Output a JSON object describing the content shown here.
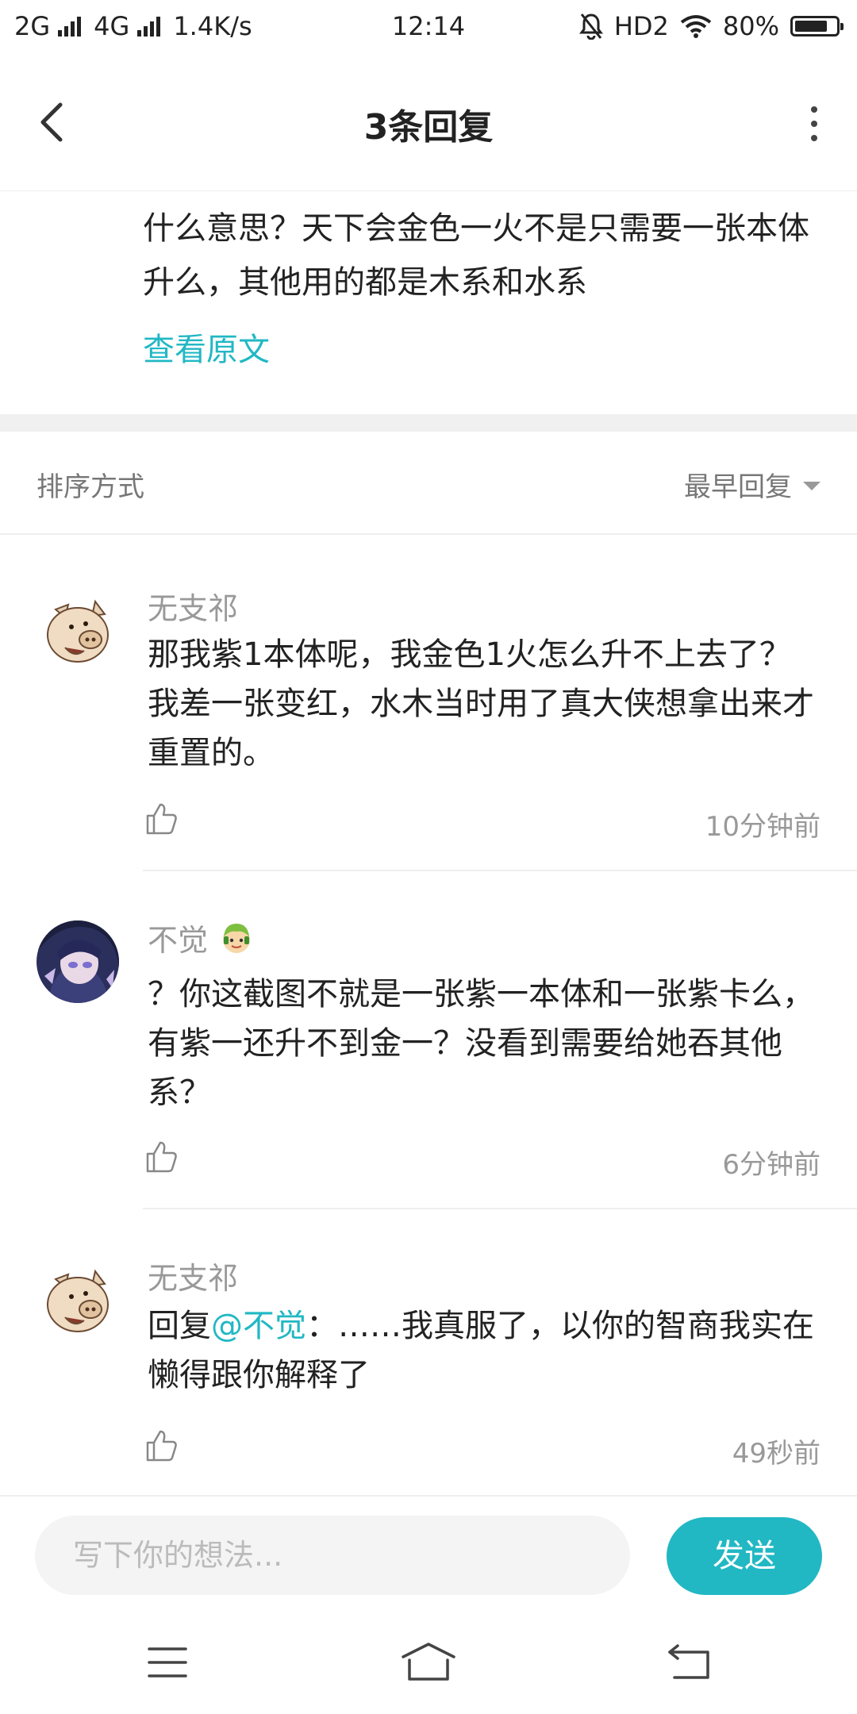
{
  "status_bar": {
    "net1": "2G",
    "net2": "4G",
    "speed": "1.4K/s",
    "time": "12:14",
    "hd": "HD2",
    "battery": "80%",
    "battery_level": 0.8
  },
  "header": {
    "title": "3条回复"
  },
  "original": {
    "text": "什么意思？天下会金色一火不是只需要一张本体升么，其他用的都是木系和水系",
    "view_link": "查看原文"
  },
  "sort": {
    "label": "排序方式",
    "value": "最早回复"
  },
  "comments": [
    {
      "name": "无支祁",
      "text": "那我紫1本体呢，我金色1火怎么升不上去了？我差一张变红，水木当时用了真大侠想拿出来才重置的。",
      "time": "10分钟前"
    },
    {
      "name": "不觉",
      "text": "？你这截图不就是一张紫一本体和一张紫卡么，有紫一还升不到金一？没看到需要给她吞其他系？",
      "time": "6分钟前"
    },
    {
      "name": "无支祁",
      "reply_prefix": "回复",
      "mention": "@不觉",
      "text": "：……我真服了，以你的智商我实在懒得跟你解释了",
      "time": "49秒前"
    }
  ],
  "input": {
    "placeholder": "写下你的想法...",
    "send_label": "发送"
  },
  "colors": {
    "accent": "#21b8c4"
  }
}
